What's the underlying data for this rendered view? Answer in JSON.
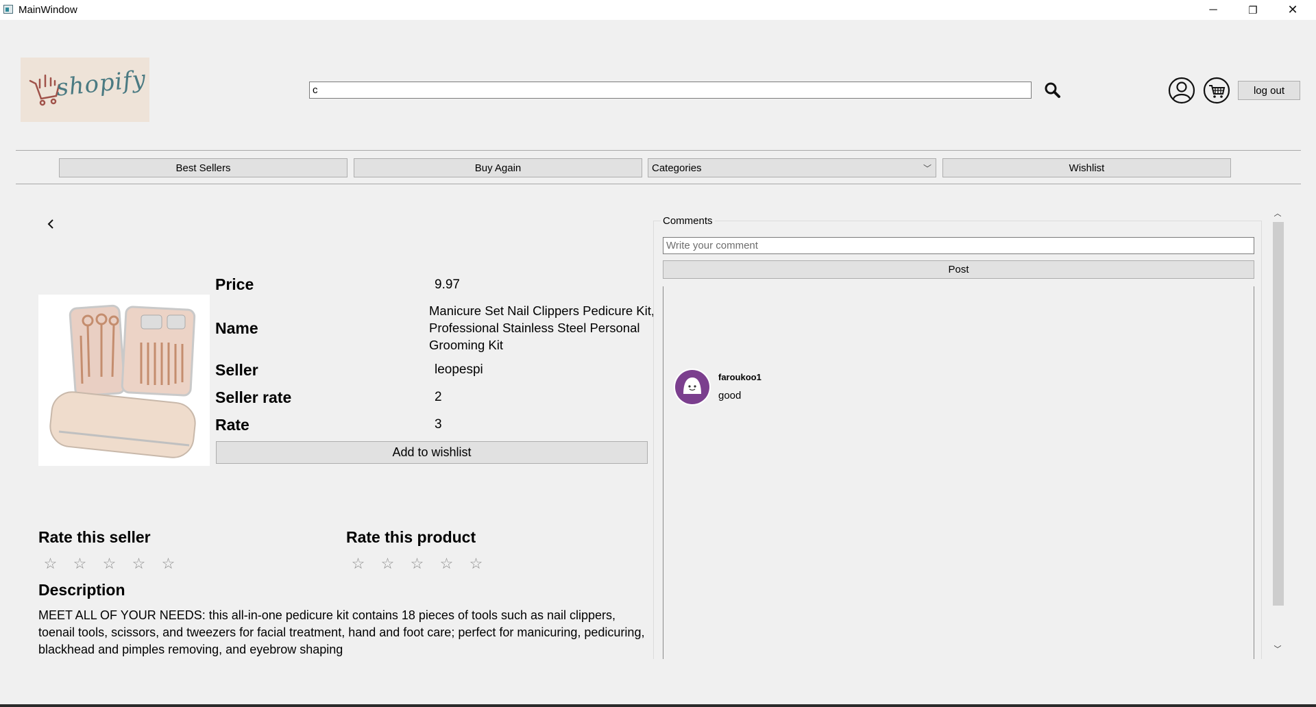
{
  "window": {
    "title": "MainWindow",
    "minimize_icon": "─",
    "maximize_icon": "❐",
    "close_icon": "✕"
  },
  "header": {
    "logo_text": "shopify",
    "search": {
      "value": "c",
      "icon": "search-icon"
    },
    "profile_icon": "user-circle-icon",
    "cart_icon": "cart-icon",
    "logout_label": "log out"
  },
  "nav": {
    "best_sellers": "Best Sellers",
    "buy_again": "Buy Again",
    "categories": "Categories",
    "wishlist": "Wishlist"
  },
  "product": {
    "labels": {
      "price": "Price",
      "name": "Name",
      "seller": "Seller",
      "seller_rate": "Seller rate",
      "rate": "Rate"
    },
    "price": "9.97",
    "name": "Manicure Set Nail Clippers Pedicure Kit, Professional Stainless Steel Personal Grooming Kit",
    "seller": "leopespi",
    "seller_rate": "2",
    "rate": "3",
    "add_to_wishlist": "Add to wishlist",
    "rate_seller_title": "Rate this seller",
    "rate_product_title": "Rate this product",
    "star_glyph": "☆",
    "description_title": "Description",
    "description": "MEET ALL OF YOUR NEEDS: this all-in-one pedicure kit contains 18 pieces of tools such as nail clippers, toenail tools, scissors, and tweezers for facial treatment, hand and foot care; perfect for manicuring, pedicuring, blackhead and pimples removing, and eyebrow shaping"
  },
  "comments": {
    "title": "Comments",
    "input_placeholder": "Write your comment",
    "post_label": "Post",
    "items": [
      {
        "user": "faroukoo1",
        "text": "good"
      }
    ]
  },
  "colors": {
    "background": "#f0f0f0",
    "button": "#e1e1e1",
    "avatar": "#7b3f8e",
    "logo_bg": "#eee3d8",
    "logo_text": "#4a7a82",
    "cart_logo": "#a0524a"
  }
}
